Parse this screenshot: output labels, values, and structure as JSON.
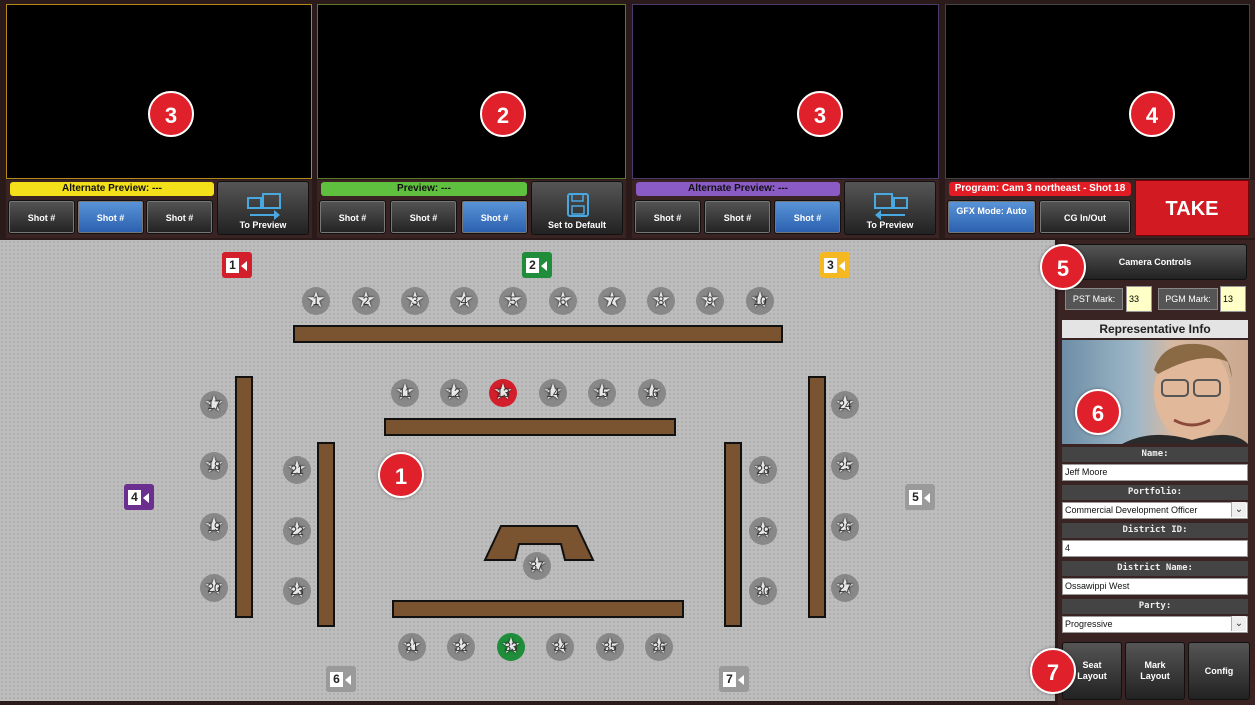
{
  "monitors": {
    "alt1": {
      "label": "Alternate Preview: ---",
      "badge": "3",
      "color": "#f4e01a",
      "shots": [
        "Shot #",
        "Shot #",
        "Shot #"
      ],
      "action": "To Preview"
    },
    "preview": {
      "label": "Preview: ---",
      "badge": "2",
      "color": "#5fbf3f",
      "shots": [
        "Shot #",
        "Shot #",
        "Shot #"
      ],
      "action": "Set to Default"
    },
    "alt2": {
      "label": "Alternate Preview: ---",
      "badge": "3",
      "color": "#8a5bc5",
      "shots": [
        "Shot #",
        "Shot #",
        "Shot #"
      ],
      "action": "To Preview"
    },
    "program": {
      "label": "Program: Cam 3 northeast - Shot 18",
      "badge": "4",
      "color": "#e21c24",
      "gfx_mode": "GFX Mode: Auto",
      "cg": "CG In/Out",
      "take": "TAKE"
    }
  },
  "floor": {
    "badge": "1",
    "cameras": [
      {
        "n": "1",
        "color": "#d21f2b"
      },
      {
        "n": "2",
        "color": "#1f8d3a"
      },
      {
        "n": "3",
        "color": "#f6b820"
      },
      {
        "n": "4",
        "color": "#6b2f8f"
      },
      {
        "n": "5",
        "color": "#9a9a9a"
      },
      {
        "n": "6",
        "color": "#9a9a9a"
      },
      {
        "n": "7",
        "color": "#9a9a9a"
      }
    ],
    "seats": [
      "1",
      "2",
      "3",
      "4",
      "5",
      "6",
      "7",
      "8",
      "9",
      "10",
      "11",
      "12",
      "13",
      "14",
      "15",
      "16",
      "17",
      "18",
      "19",
      "20",
      "21",
      "22",
      "23",
      "24",
      "25",
      "26",
      "27",
      "28",
      "29",
      "30",
      "31",
      "32",
      "33",
      "34",
      "35",
      "36",
      "37"
    ],
    "pst_seat": "13",
    "pgm_seat": "33"
  },
  "side": {
    "badge_camera": "5",
    "camera_controls": "Camera Controls",
    "pst_label": "PST Mark:",
    "pst_value": "33",
    "pgm_label": "PGM Mark:",
    "pgm_value": "13",
    "rep_header": "Representative Info",
    "badge_photo": "6",
    "fields": {
      "name_label": "Name:",
      "name": "Jeff Moore",
      "portfolio_label": "Portfolio:",
      "portfolio": "Commercial Development Officer",
      "district_id_label": "District ID:",
      "district_id": "4",
      "district_name_label": "District Name:",
      "district_name": "Ossawippi West",
      "party_label": "Party:",
      "party": "Progressive"
    },
    "badge_layout": "7",
    "buttons": {
      "seat_layout": "Seat Layout",
      "mark_layout": "Mark Layout",
      "config": "Config"
    }
  }
}
